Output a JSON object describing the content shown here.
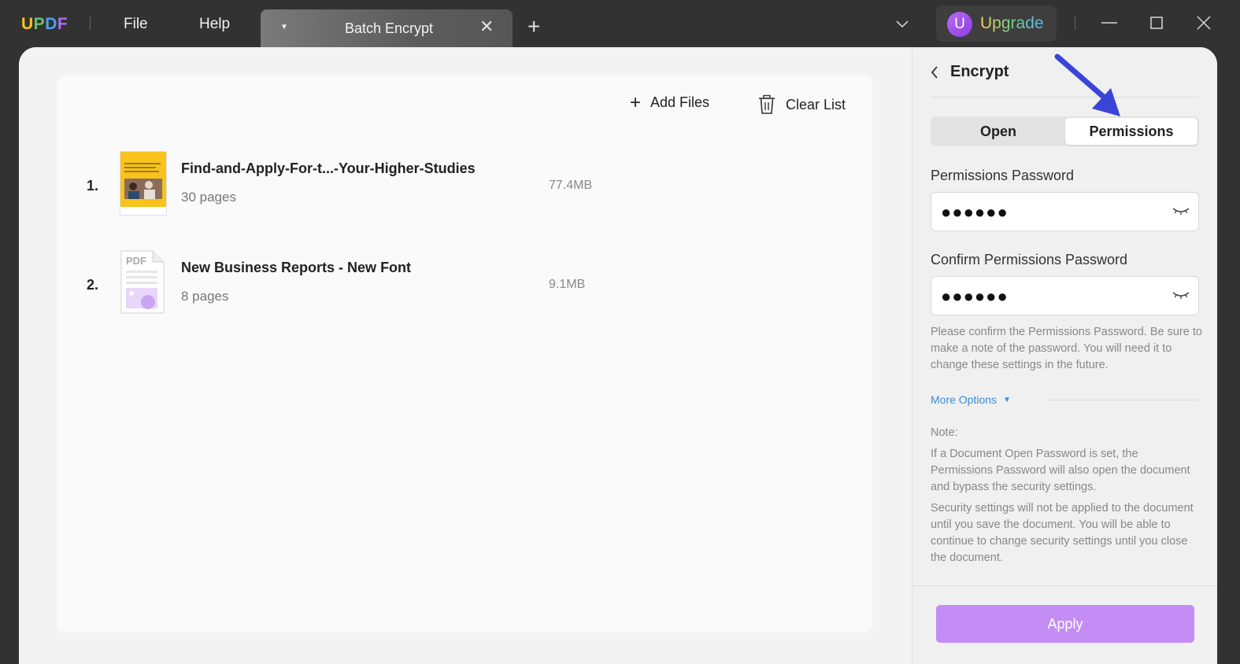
{
  "app": {
    "logo": {
      "u": "U",
      "p": "P",
      "d": "D",
      "f": "F"
    },
    "menu": {
      "file": "File",
      "help": "Help"
    },
    "tab": {
      "title": "Batch Encrypt",
      "close": "✕"
    },
    "new_tab": "+",
    "upgrade": {
      "avatar_letter": "U",
      "label": "Upgrade"
    }
  },
  "toolbar": {
    "add_files": "Add Files",
    "add_icon": "+",
    "clear_list": "Clear List"
  },
  "files": [
    {
      "num": "1.",
      "name": "Find-and-Apply-For-t...-Your-Higher-Studies",
      "pages": "30 pages",
      "size": "77.4MB"
    },
    {
      "num": "2.",
      "name": "New Business Reports - New Font",
      "pages": "8 pages",
      "size": "9.1MB"
    }
  ],
  "panel": {
    "title": "Encrypt",
    "tabs": {
      "open": "Open",
      "permissions": "Permissions"
    },
    "permissions_password_label": "Permissions Password",
    "permissions_password_value": "●●●●●●",
    "confirm_label": "Confirm Permissions Password",
    "confirm_value": "●●●●●●",
    "helper": "Please confirm the Permissions Password. Be sure to make a note of the password. You will need it to change these settings in the future.",
    "more_options": "More Options",
    "note_title": "Note:",
    "note_p1": "If a Document Open Password is set, the Permissions Password will also open the document and bypass the security settings.",
    "note_p2": "Security settings will not be applied to the document until you save the document. You will be able to continue to change security settings until you close the document.",
    "apply": "Apply"
  },
  "colors": {
    "accent": "#c48cf5",
    "arrow": "#3a45d8",
    "link": "#3b8ed8"
  },
  "icons": [
    "caret-down-icon",
    "close-icon",
    "plus-icon",
    "chevron-down-icon",
    "minimize-icon",
    "maximize-icon",
    "trash-icon",
    "chevron-left-icon",
    "eye-closed-icon",
    "triangle-down-icon"
  ]
}
